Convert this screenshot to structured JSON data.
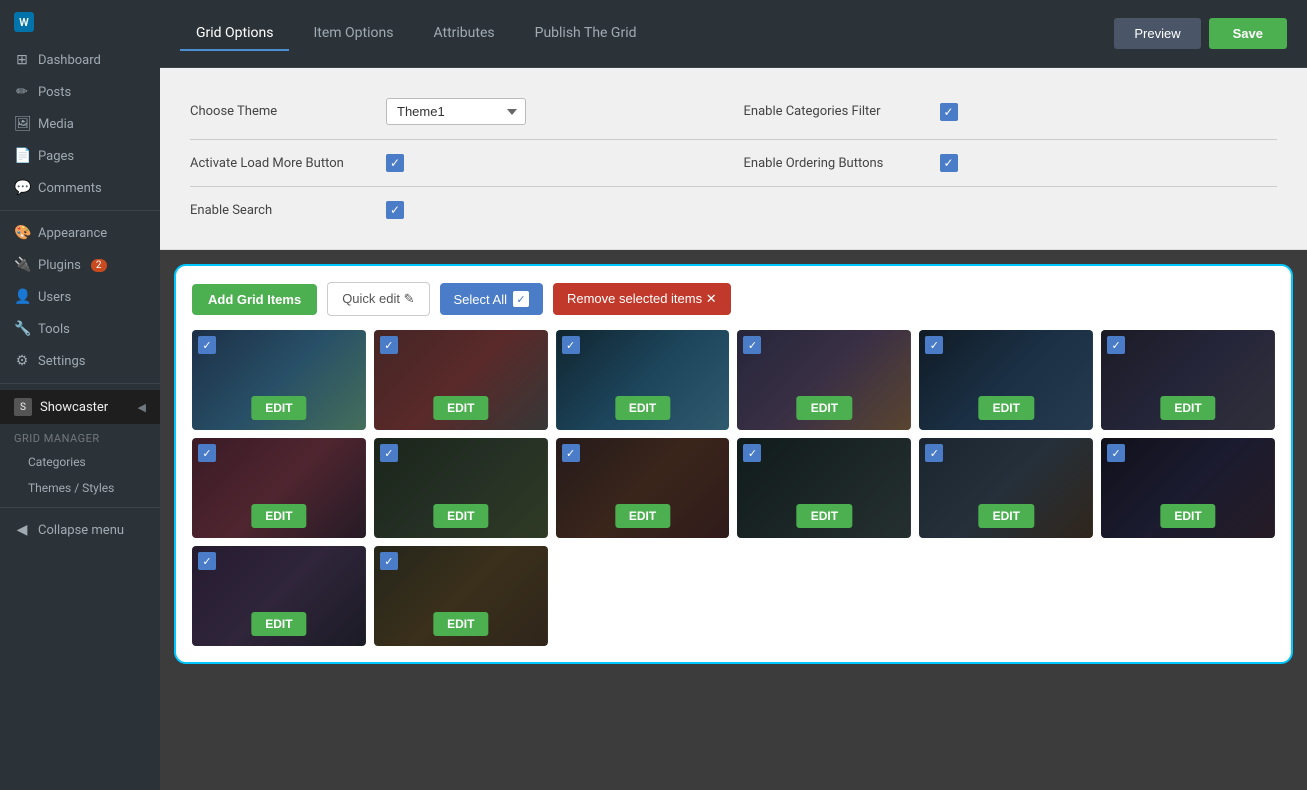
{
  "sidebar": {
    "logo": "W",
    "logo_title": "WordPress",
    "items": [
      {
        "id": "dashboard",
        "label": "Dashboard",
        "icon": "⊞"
      },
      {
        "id": "posts",
        "label": "Posts",
        "icon": "📝"
      },
      {
        "id": "media",
        "label": "Media",
        "icon": "🖼"
      },
      {
        "id": "pages",
        "label": "Pages",
        "icon": "📄"
      },
      {
        "id": "comments",
        "label": "Comments",
        "icon": "💬"
      },
      {
        "id": "appearance",
        "label": "Appearance",
        "icon": "🎨"
      },
      {
        "id": "plugins",
        "label": "Plugins",
        "icon": "🔌",
        "badge": "2"
      },
      {
        "id": "users",
        "label": "Users",
        "icon": "👤"
      },
      {
        "id": "tools",
        "label": "Tools",
        "icon": "🔧"
      },
      {
        "id": "settings",
        "label": "Settings",
        "icon": "⚙"
      }
    ],
    "showcaster_label": "Showcaster",
    "grid_manager_label": "Grid Manager",
    "sub_items": [
      "Categories",
      "Themes / Styles"
    ],
    "collapse_label": "Collapse menu"
  },
  "tabs": [
    {
      "id": "grid-options",
      "label": "Grid Options",
      "active": true
    },
    {
      "id": "item-options",
      "label": "Item Options",
      "active": false
    },
    {
      "id": "attributes",
      "label": "Attributes",
      "active": false
    },
    {
      "id": "publish-the-grid",
      "label": "Publish The Grid",
      "active": false
    }
  ],
  "header_buttons": {
    "preview": "Preview",
    "save": "Save"
  },
  "grid_options": {
    "choose_theme_label": "Choose Theme",
    "theme_value": "Theme1",
    "enable_categories_label": "Enable Categories Filter",
    "activate_load_more_label": "Activate Load More Button",
    "enable_ordering_label": "Enable Ordering Buttons",
    "enable_search_label": "Enable Search"
  },
  "toolbar": {
    "add_grid_items_label": "Add Grid Items",
    "quick_edit_label": "Quick edit ✎",
    "select_all_label": "Select All",
    "remove_selected_label": "Remove selected items ✕"
  },
  "grid_items": {
    "count": 14,
    "edit_label": "EDIT",
    "items": [
      {
        "id": 1,
        "color_class": "img-color-1",
        "checked": true
      },
      {
        "id": 2,
        "color_class": "img-color-2",
        "checked": true
      },
      {
        "id": 3,
        "color_class": "img-color-3",
        "checked": true
      },
      {
        "id": 4,
        "color_class": "img-color-4",
        "checked": true
      },
      {
        "id": 5,
        "color_class": "img-color-5",
        "checked": true
      },
      {
        "id": 6,
        "color_class": "img-color-6",
        "checked": true
      },
      {
        "id": 7,
        "color_class": "img-color-7",
        "checked": true
      },
      {
        "id": 8,
        "color_class": "img-color-8",
        "checked": true
      },
      {
        "id": 9,
        "color_class": "img-color-9",
        "checked": true
      },
      {
        "id": 10,
        "color_class": "img-color-10",
        "checked": true
      },
      {
        "id": 11,
        "color_class": "img-color-11",
        "checked": true
      },
      {
        "id": 12,
        "color_class": "img-color-12",
        "checked": true
      },
      {
        "id": 13,
        "color_class": "img-color-13",
        "checked": true
      },
      {
        "id": 14,
        "color_class": "img-color-14",
        "checked": true
      }
    ]
  }
}
